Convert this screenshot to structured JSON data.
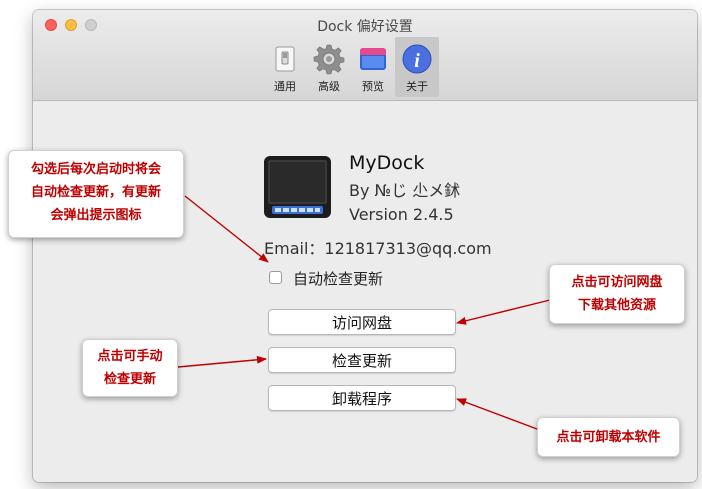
{
  "window": {
    "title": "Dock 偏好设置"
  },
  "tabs": [
    {
      "label": "通用",
      "icon": "switch-icon"
    },
    {
      "label": "高级",
      "icon": "gear-icon"
    },
    {
      "label": "预览",
      "icon": "window-icon"
    },
    {
      "label": "关于",
      "icon": "info-icon",
      "selected": true
    }
  ],
  "about": {
    "app_name": "MyDock",
    "by_line": "By №じ 尐メ鉥",
    "version": "Version 2.4.5",
    "email": "Email：121817313@qq.com"
  },
  "auto_update": {
    "label": "自动检查更新",
    "checked": false
  },
  "buttons": {
    "netdisk": "访问网盘",
    "check_update": "检查更新",
    "uninstall": "卸载程序"
  },
  "callouts": {
    "auto_update_note": [
      "勾选后每次启动时将会",
      "自动检查更新，有更新",
      "会弹出提示图标"
    ],
    "netdisk_note": [
      "点击可访问网盘",
      "下载其他资源"
    ],
    "check_update_note": [
      "点击可手动",
      "检查更新"
    ],
    "uninstall_note": [
      "点击可卸载本软件"
    ]
  },
  "colors": {
    "callout_text": "#c00000",
    "arrow": "#c00000",
    "info_blue": "#4b6fe0"
  }
}
